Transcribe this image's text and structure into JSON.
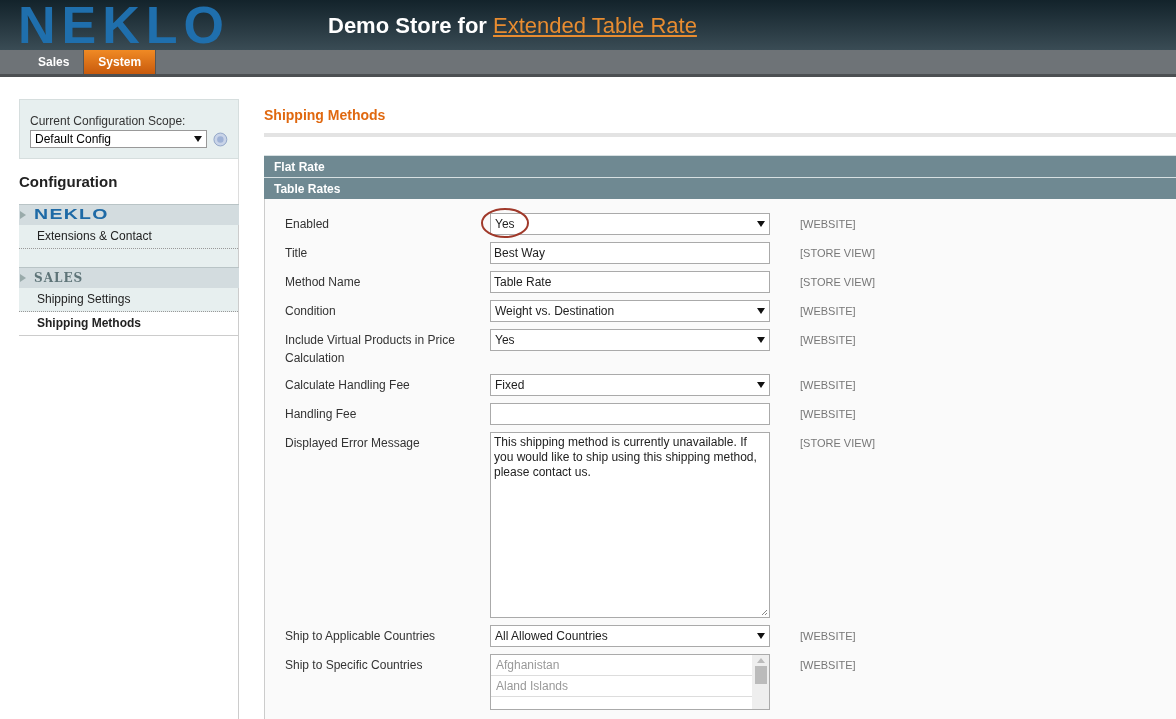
{
  "header": {
    "logo": "NEKLO",
    "title": "Demo Store for",
    "title_link": "Extended Table Rate"
  },
  "nav": [
    {
      "label": "Sales",
      "selected": false
    },
    {
      "label": "System",
      "selected": true
    }
  ],
  "sidebar": {
    "scope_label": "Current Configuration Scope:",
    "scope_value": "Default Config",
    "heading": "Configuration",
    "groups": [
      {
        "title": "NEKLO",
        "kind": "logo",
        "items": [
          {
            "label": "Extensions & Contact",
            "selected": false
          }
        ]
      },
      {
        "title": "SALES",
        "kind": "text",
        "items": [
          {
            "label": "Shipping Settings",
            "selected": false
          },
          {
            "label": "Shipping Methods",
            "selected": true
          }
        ]
      }
    ]
  },
  "page_title": "Shipping Methods",
  "sections": [
    {
      "title": "Flat Rate"
    },
    {
      "title": "Table Rates"
    }
  ],
  "fields": [
    {
      "label": "Enabled",
      "kind": "select",
      "value": "Yes",
      "scope": "[WEBSITE]",
      "circled": true
    },
    {
      "label": "Title",
      "kind": "text",
      "value": "Best Way",
      "scope": "[STORE VIEW]"
    },
    {
      "label": "Method Name",
      "kind": "text",
      "value": "Table Rate",
      "scope": "[STORE VIEW]"
    },
    {
      "label": "Condition",
      "kind": "select",
      "value": "Weight vs. Destination",
      "scope": "[WEBSITE]"
    },
    {
      "label": "Include Virtual Products in Price Calculation",
      "kind": "select",
      "value": "Yes",
      "scope": "[WEBSITE]"
    },
    {
      "label": "Calculate Handling Fee",
      "kind": "select",
      "value": "Fixed",
      "scope": "[WEBSITE]"
    },
    {
      "label": "Handling Fee",
      "kind": "text",
      "scope": "[WEBSITE]"
    },
    {
      "label": "Displayed Error Message",
      "kind": "textarea",
      "value": "This shipping method is currently unavailable. If you would like to ship using this shipping method, please contact us.",
      "scope": "[STORE VIEW]"
    },
    {
      "label": "Ship to Applicable Countries",
      "kind": "select",
      "value": "All Allowed Countries",
      "scope": "[WEBSITE]"
    },
    {
      "label": "Ship to Specific Countries",
      "kind": "listbox",
      "options": [
        "Afghanistan",
        "Aland Islands"
      ],
      "scope": "[WEBSITE]"
    }
  ]
}
